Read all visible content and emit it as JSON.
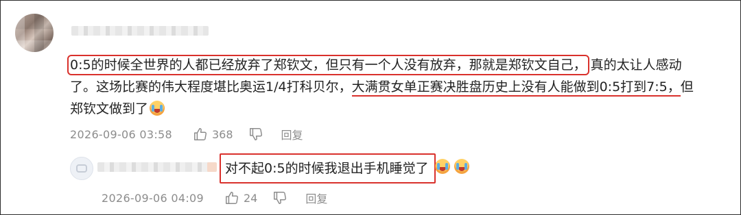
{
  "comment": {
    "line1_boxed": "0:5的时候全世界的人都已经放弃了郑钦文，但只有一个人没有放弃，那就是郑钦文自己，",
    "line1_rest": "真的太让人感动",
    "line2_start": "了。这场比赛的伟大程度堪比奥运1/4打科贝尔，",
    "line2_underlined": "大满贯女单正赛决胜盘历史上没有人能做到0:5打到7:5，",
    "line2_end": "但",
    "line3": "郑钦文做到了",
    "emoji": "crying-face-icon",
    "date": "2026-09-06 03:58",
    "likes": "368",
    "reply_label": "回复"
  },
  "reply": {
    "text": "对不起0:5的时候我退出手机睡觉了",
    "emojis": [
      "crying-face-icon",
      "crying-face-icon"
    ],
    "date": "2026-09-06 04:09",
    "likes": "24",
    "reply_label": "回复"
  },
  "colors": {
    "highlight": "#d9302b",
    "meta_text": "#8c8c8c"
  }
}
